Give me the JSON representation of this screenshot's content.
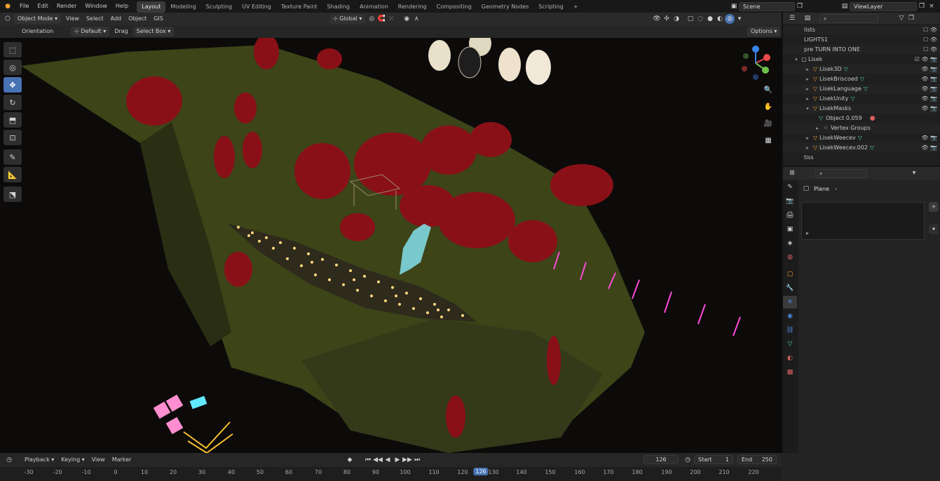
{
  "topbar": {
    "menus": [
      "File",
      "Edit",
      "Render",
      "Window",
      "Help"
    ],
    "workspaces": [
      "Layout",
      "Modeling",
      "Sculpting",
      "UV Editing",
      "Texture Paint",
      "Shading",
      "Animation",
      "Rendering",
      "Compositing",
      "Geometry Nodes",
      "Scripting"
    ],
    "active_workspace": "Layout",
    "scene": "Scene",
    "view_layer": "ViewLayer"
  },
  "viewport_header": {
    "mode": "Object Mode",
    "menus": [
      "View",
      "Select",
      "Add",
      "Object",
      "GIS"
    ],
    "orientation": "Global",
    "options_label": "Options"
  },
  "tool_header": {
    "label": "Orientation",
    "orientation_value": "Default",
    "drag_label": "Drag",
    "drag_value": "Select Box"
  },
  "toolbar": {
    "tools": [
      "select-box",
      "cursor",
      "move",
      "rotate",
      "scale",
      "transform",
      "annotate",
      "measure",
      "add-cube"
    ],
    "active": "move"
  },
  "nav_gizmo": {
    "axes": [
      "X",
      "Y",
      "Z"
    ],
    "colors": {
      "x": "#e94b4b",
      "y": "#6cc04a",
      "z": "#3b82e6"
    }
  },
  "outliner": {
    "search_placeholder": "",
    "rows": [
      {
        "label": "lists",
        "indent": 0,
        "tri": "",
        "icons": "☐ 👁"
      },
      {
        "label": "LIGHTS1",
        "indent": 0,
        "tri": "",
        "icons": "☐ 👁"
      },
      {
        "label": "pre TURN INTO ONE",
        "indent": 0,
        "tri": "",
        "icons": "☐ 👁"
      },
      {
        "label": "Lisek",
        "indent": 0,
        "tri": "▾",
        "icons": "☑ 👁 📷"
      },
      {
        "label": "Lisek3D",
        "indent": 1,
        "tri": "▸",
        "icons": "👁 📷"
      },
      {
        "label": "LisekBriscoed",
        "indent": 1,
        "tri": "▸",
        "icons": "👁 📷"
      },
      {
        "label": "LisekLanguage",
        "indent": 1,
        "tri": "▸",
        "icons": "👁 📷"
      },
      {
        "label": "LisekUnity",
        "indent": 1,
        "tri": "▸",
        "icons": "👁 📷"
      },
      {
        "label": "LisekMasks",
        "indent": 1,
        "tri": "▾",
        "icons": "👁 📷"
      },
      {
        "label": "Object 0.059",
        "indent": 2,
        "tri": "",
        "icons": ""
      },
      {
        "label": "Vertex Groups",
        "indent": 2,
        "tri": "▸",
        "icons": ""
      },
      {
        "label": "LisekWeecev",
        "indent": 1,
        "tri": "▸",
        "icons": "👁 📷"
      },
      {
        "label": "LisekWeecev.002",
        "indent": 1,
        "tri": "▸",
        "icons": "👁 📷"
      },
      {
        "label": "tiss",
        "indent": 0,
        "tri": "",
        "icons": ""
      }
    ]
  },
  "properties": {
    "object_name": "Plane",
    "search_placeholder": ""
  },
  "timeline": {
    "menus": [
      "Playback",
      "Keying",
      "View",
      "Marker"
    ],
    "current_frame": "126",
    "start_label": "Start",
    "start": "1",
    "end_label": "End",
    "end": "250",
    "ticks": [
      "-30",
      "-20",
      "-10",
      "0",
      "10",
      "20",
      "30",
      "40",
      "50",
      "60",
      "70",
      "80",
      "90",
      "100",
      "110",
      "120",
      "126",
      "130",
      "140",
      "150",
      "160",
      "170",
      "180",
      "190",
      "200",
      "210",
      "220"
    ]
  }
}
